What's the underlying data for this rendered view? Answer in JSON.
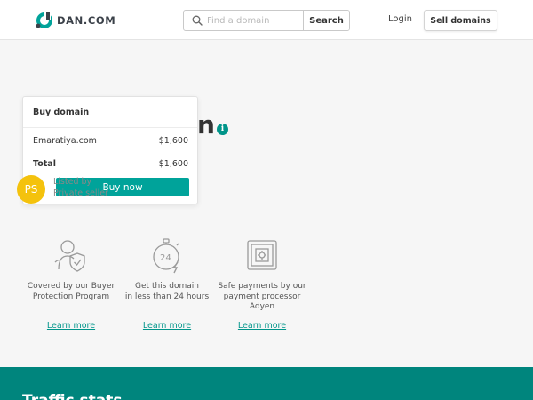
{
  "header": {
    "logo_text": "DAN.COM",
    "search_placeholder": "Find a domain",
    "search_button": "Search",
    "login": "Login",
    "sell_button": "Sell domains"
  },
  "domain": {
    "title_fragment": "n",
    "info_icon": "i"
  },
  "buy_card": {
    "title": "Buy domain",
    "item_label": "Emaratiya.com",
    "item_price": "$1,600",
    "total_label": "Total",
    "total_price": "$1,600",
    "buy_button": "Buy now"
  },
  "seller": {
    "initials": "PS",
    "listed_by": "Listed by",
    "name": "Private seller",
    "avatar_color": "#f4c20d"
  },
  "features": [
    {
      "icon": "buyer-protection-icon",
      "text_line1": "Covered by our Buyer",
      "text_line2": "Protection Program",
      "text_line3": "",
      "link": "Learn more"
    },
    {
      "icon": "24-hour-clock-icon",
      "text_line1": "Get this domain",
      "text_line2": "in less than 24 hours",
      "text_line3": "",
      "link": "Learn more"
    },
    {
      "icon": "safe-payment-icon",
      "text_line1": "Safe payments by our",
      "text_line2": "payment processor",
      "text_line3": "Adyen",
      "link": "Learn more"
    }
  ],
  "traffic": {
    "title": "Traffic stats"
  },
  "colors": {
    "accent": "#00a39a",
    "band": "#00857d"
  }
}
